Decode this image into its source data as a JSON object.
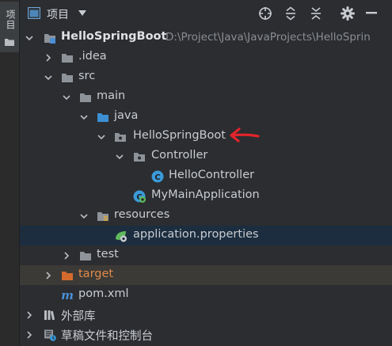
{
  "side_tab": {
    "label": "项目"
  },
  "header": {
    "title": "项目"
  },
  "tree": {
    "root": {
      "label": "HelloSpringBoot",
      "path": "D:\\Project\\Java\\JavaProjects\\HelloSprin"
    },
    "idea": {
      "label": ".idea"
    },
    "src": {
      "label": "src"
    },
    "main": {
      "label": "main"
    },
    "java": {
      "label": "java"
    },
    "pkg": {
      "label": "HelloSpringBoot"
    },
    "controller": {
      "label": "Controller"
    },
    "hello_controller": {
      "label": "HelloController"
    },
    "main_app": {
      "label": "MyMainApplication"
    },
    "resources": {
      "label": "resources"
    },
    "app_props": {
      "label": "application.properties"
    },
    "test": {
      "label": "test"
    },
    "target": {
      "label": "target"
    },
    "pom": {
      "label": "pom.xml"
    },
    "ext_libs": {
      "label": "外部库"
    },
    "scratches": {
      "label": "草稿文件和控制台"
    }
  },
  "colors": {
    "selected_row": "#1c2d3f",
    "excluded_row": "#3c3a36",
    "folder": "#8e939a",
    "source_folder": "#3d8fd1",
    "target_folder": "#d46b2d",
    "class_icon": "#3b9ad9",
    "spring": "#5fb85c",
    "annotation_arrow": "#e0252b"
  }
}
